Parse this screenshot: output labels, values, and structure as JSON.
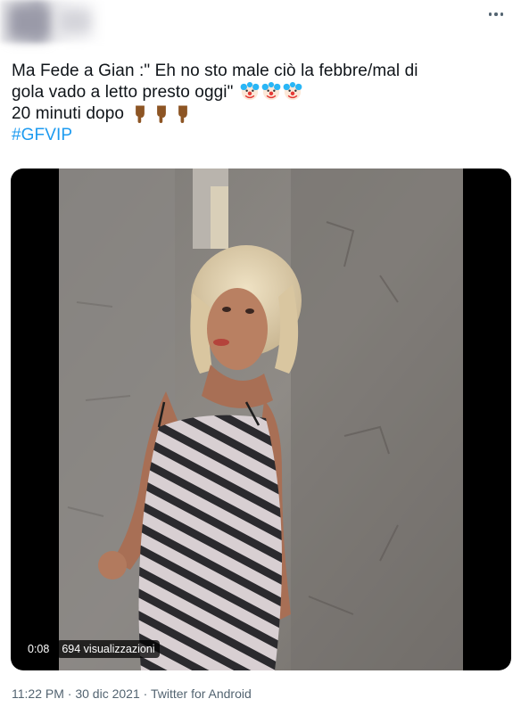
{
  "tweet": {
    "text_line1": "Ma Fede a Gian :\" Eh no sto male ciò la febbre/mal di",
    "text_line2": "gola vado a letto presto oggi\"",
    "text_line3": "20 minuti dopo",
    "hashtag": "#GFVIP"
  },
  "video": {
    "time": "0:08",
    "views": "694 visualizzazioni"
  },
  "meta": {
    "time": "11:22 PM",
    "separator": "·",
    "date": "30 dic 2021",
    "source": "Twitter for Android"
  },
  "icons": {
    "more": "more-dots-icon",
    "clown": "clown-face-emoji",
    "point_down": "point-down-emoji"
  }
}
